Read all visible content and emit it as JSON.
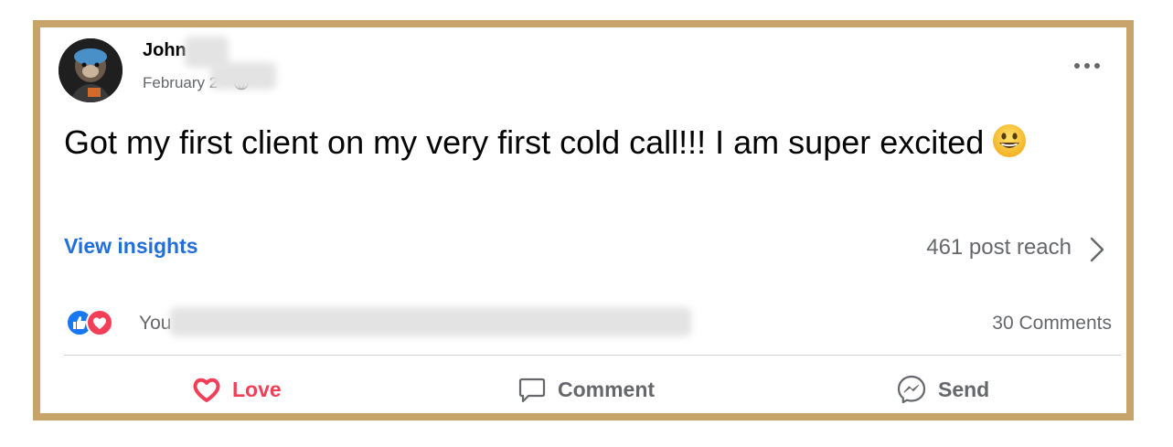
{
  "post": {
    "author_name": "John",
    "date": "February 2 ·",
    "text": "Got my first client on my very first cold call!!! I am super excited",
    "more_label": "•••"
  },
  "insights": {
    "link_label": "View insights",
    "reach_label": "461 post reach"
  },
  "engagement": {
    "reactors_prefix": "You",
    "comments_count": "30 Comments"
  },
  "actions": [
    {
      "label": "Love",
      "icon": "heart-outline-icon"
    },
    {
      "label": "Comment",
      "icon": "comment-bubble-icon"
    },
    {
      "label": "Send",
      "icon": "messenger-icon"
    }
  ],
  "colors": {
    "frame": "#c8a46a",
    "link_blue": "#216fdb",
    "love_red": "#f33e58",
    "muted": "#65676b",
    "like_blue": "#1877f2"
  }
}
